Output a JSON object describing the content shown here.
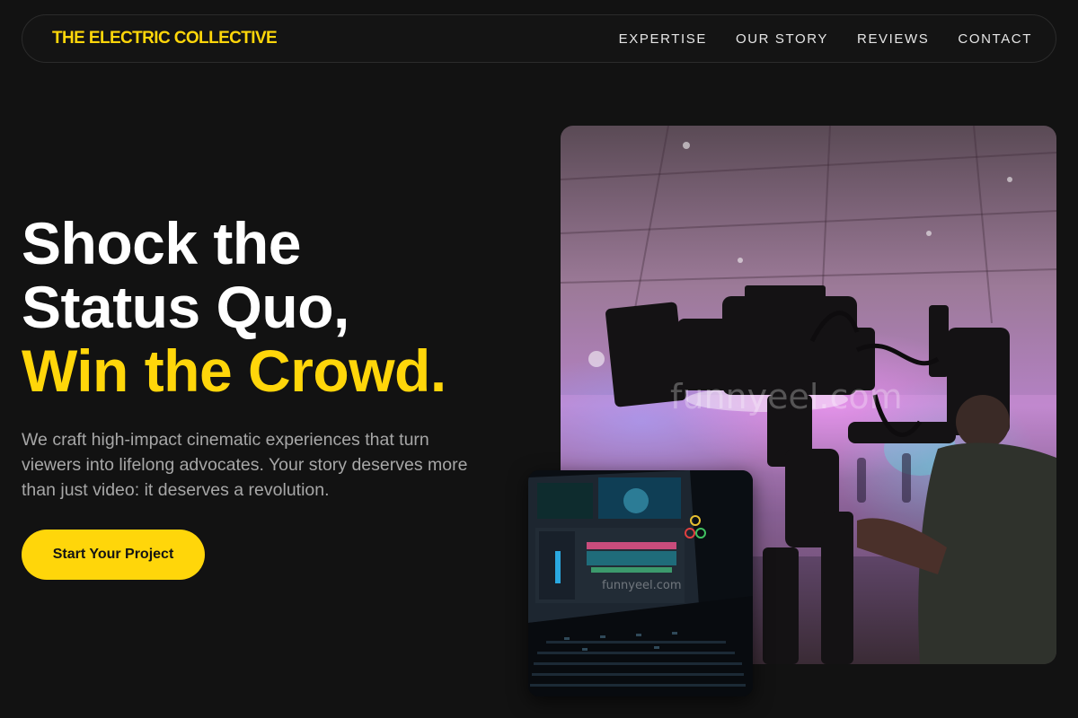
{
  "nav": {
    "brand": "THE ELECTRIC COLLECTIVE",
    "links": [
      "EXPERTISE",
      "OUR STORY",
      "REVIEWS",
      "CONTACT"
    ]
  },
  "hero": {
    "headline_line1": "Shock the",
    "headline_line2": "Status Quo,",
    "headline_line3": "Win the Crowd.",
    "description": "We craft high-impact cinematic experiences that turn viewers into lifelong advocates. Your story deserves more than just video: it deserves a revolution.",
    "cta_label": "Start Your Project"
  },
  "images": {
    "main_photo": "camera-operator-photo",
    "secondary_photo": "editing-laptop-photo",
    "watermark": "funnyeel.com"
  },
  "colors": {
    "accent": "#ffd60a",
    "background": "#121212",
    "text_primary": "#ffffff",
    "text_muted": "#a7a7a7"
  }
}
